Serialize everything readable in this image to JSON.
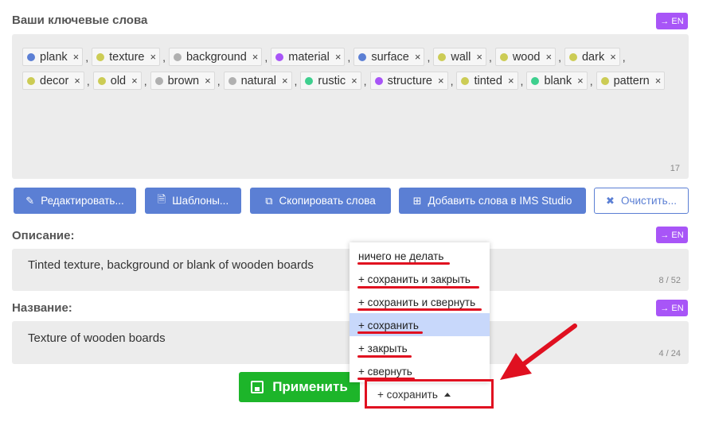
{
  "keywords": {
    "title": "Ваши ключевые слова",
    "lang_label": "→ EN",
    "count": "17",
    "items": [
      {
        "label": "plank",
        "color": "#5b7fd4"
      },
      {
        "label": "texture",
        "color": "#cccc55"
      },
      {
        "label": "background",
        "color": "#b0b0b0"
      },
      {
        "label": "material",
        "color": "#a855f7"
      },
      {
        "label": "surface",
        "color": "#5b7fd4"
      },
      {
        "label": "wall",
        "color": "#cccc55"
      },
      {
        "label": "wood",
        "color": "#cccc55"
      },
      {
        "label": "dark",
        "color": "#cccc55"
      },
      {
        "label": "decor",
        "color": "#cccc55"
      },
      {
        "label": "old",
        "color": "#cccc55"
      },
      {
        "label": "brown",
        "color": "#b0b0b0"
      },
      {
        "label": "natural",
        "color": "#b0b0b0"
      },
      {
        "label": "rustic",
        "color": "#3ecf8e"
      },
      {
        "label": "structure",
        "color": "#a855f7"
      },
      {
        "label": "tinted",
        "color": "#cccc55"
      },
      {
        "label": "blank",
        "color": "#3ecf8e"
      },
      {
        "label": "pattern",
        "color": "#cccc55"
      }
    ],
    "remove_glyph": "×",
    "separator": ","
  },
  "toolbar": {
    "edit_label": "Редактировать...",
    "templates_label": "Шаблоны...",
    "copy_label": "Скопировать слова",
    "add_ims_label": "Добавить слова в IMS Studio",
    "clear_label": "Очистить..."
  },
  "description": {
    "title": "Описание:",
    "lang_label": "→ EN",
    "value": "Tinted texture, background or blank of wooden boards",
    "counter": "8 / 52"
  },
  "name": {
    "title": "Название:",
    "lang_label": "→ EN",
    "value": "Texture of wooden boards",
    "counter": "4 / 24"
  },
  "apply_label": "Применить",
  "after_apply": {
    "selected": "+ сохранить",
    "options": [
      "ничего не делать",
      "+ сохранить и закрыть",
      "+ сохранить и свернуть",
      "+ сохранить",
      "+ закрыть",
      "+ свернуть"
    ]
  },
  "colors": {
    "accent": "#5b7fd4",
    "lang": "#a855f7",
    "apply": "#1db52a",
    "annotation": "#e01020"
  }
}
